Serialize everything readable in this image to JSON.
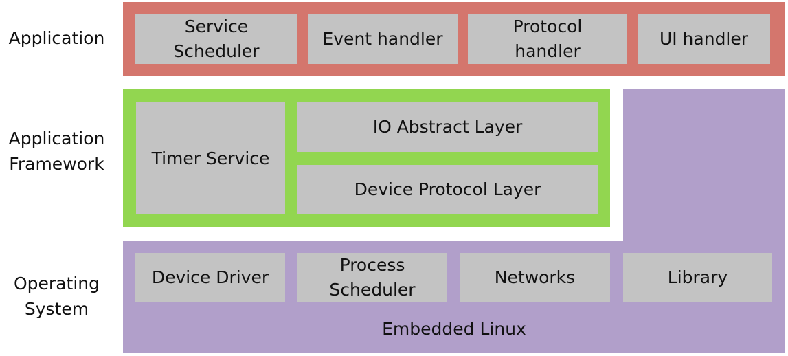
{
  "colors": {
    "application": "#d4766d",
    "framework": "#92d650",
    "os": "#b19fca",
    "module": "#c3c3c3"
  },
  "layers": {
    "application": {
      "label": "Application",
      "modules": [
        "Service\nScheduler",
        "Event handler",
        "Protocol\nhandler",
        "UI handler"
      ]
    },
    "framework": {
      "label": "Application\nFramework",
      "modules": [
        "Timer Service",
        "IO Abstract Layer",
        "Device Protocol Layer"
      ]
    },
    "os": {
      "label": "Operating\nSystem",
      "modules": [
        "Device Driver",
        "Process\nScheduler",
        "Networks",
        "Library"
      ],
      "footer": "Embedded Linux"
    }
  }
}
